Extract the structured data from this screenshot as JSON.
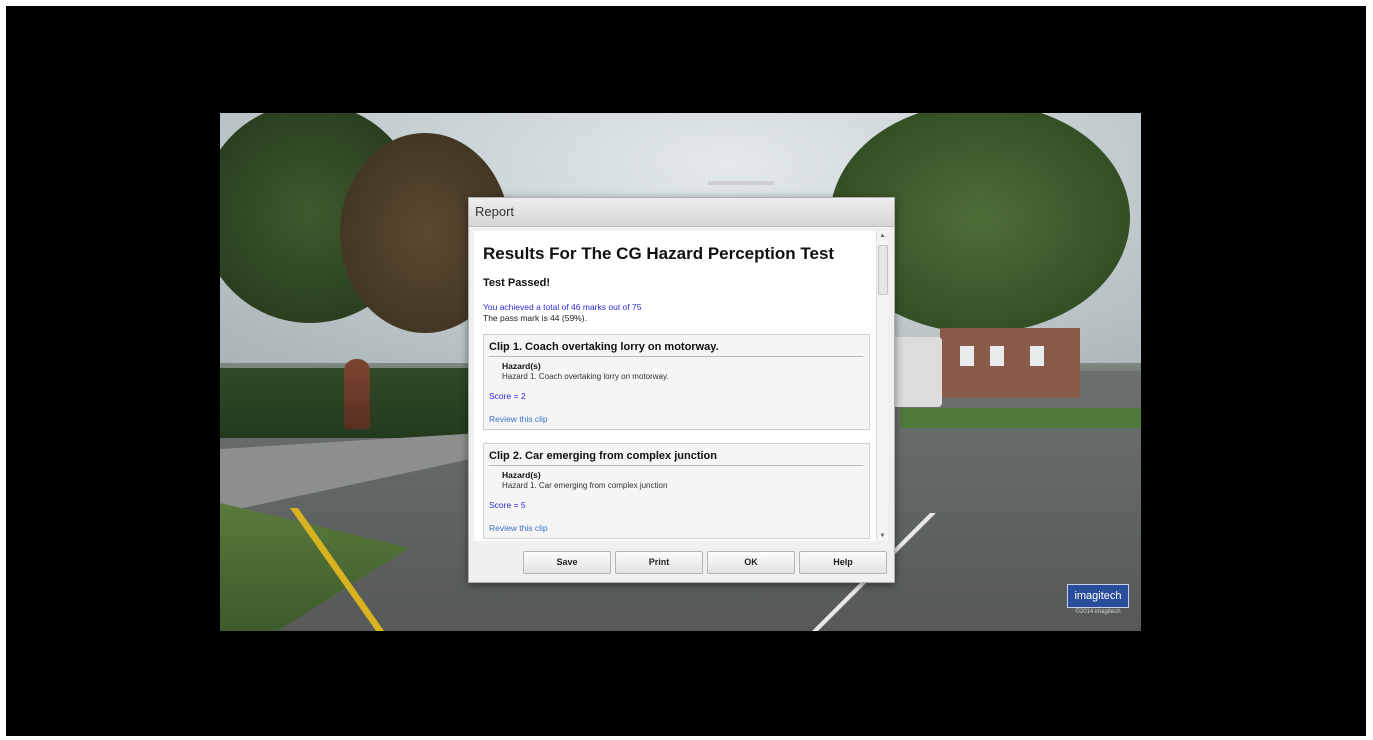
{
  "dialog": {
    "title": "Report",
    "heading": "Results For The CG Hazard Perception Test",
    "status": "Test Passed!",
    "achieved": "You achieved a total of 46 marks out of 75",
    "pass_mark": "The pass mark is 44 (59%)."
  },
  "clips": [
    {
      "title": "Clip 1. Coach overtaking lorry on motorway.",
      "hazards_heading": "Hazard(s)",
      "hazard": "Hazard 1. Coach overtaking lorry on motorway.",
      "score": "Score = 2",
      "review": "Review this clip"
    },
    {
      "title": "Clip 2. Car emerging from complex junction",
      "hazards_heading": "Hazard(s)",
      "hazard": "Hazard 1. Car emerging from complex junction",
      "score": "Score = 5",
      "review": "Review this clip"
    }
  ],
  "buttons": {
    "save": "Save",
    "print": "Print",
    "ok": "OK",
    "help": "Help"
  },
  "scrollbar": {
    "up_icon": "▲",
    "down_icon": "▼"
  },
  "logo": {
    "name": "imagitech",
    "sub": "©2014 imagitech"
  },
  "colors": {
    "link_blue": "#2b2bd8",
    "review_blue": "#3a72c9"
  }
}
